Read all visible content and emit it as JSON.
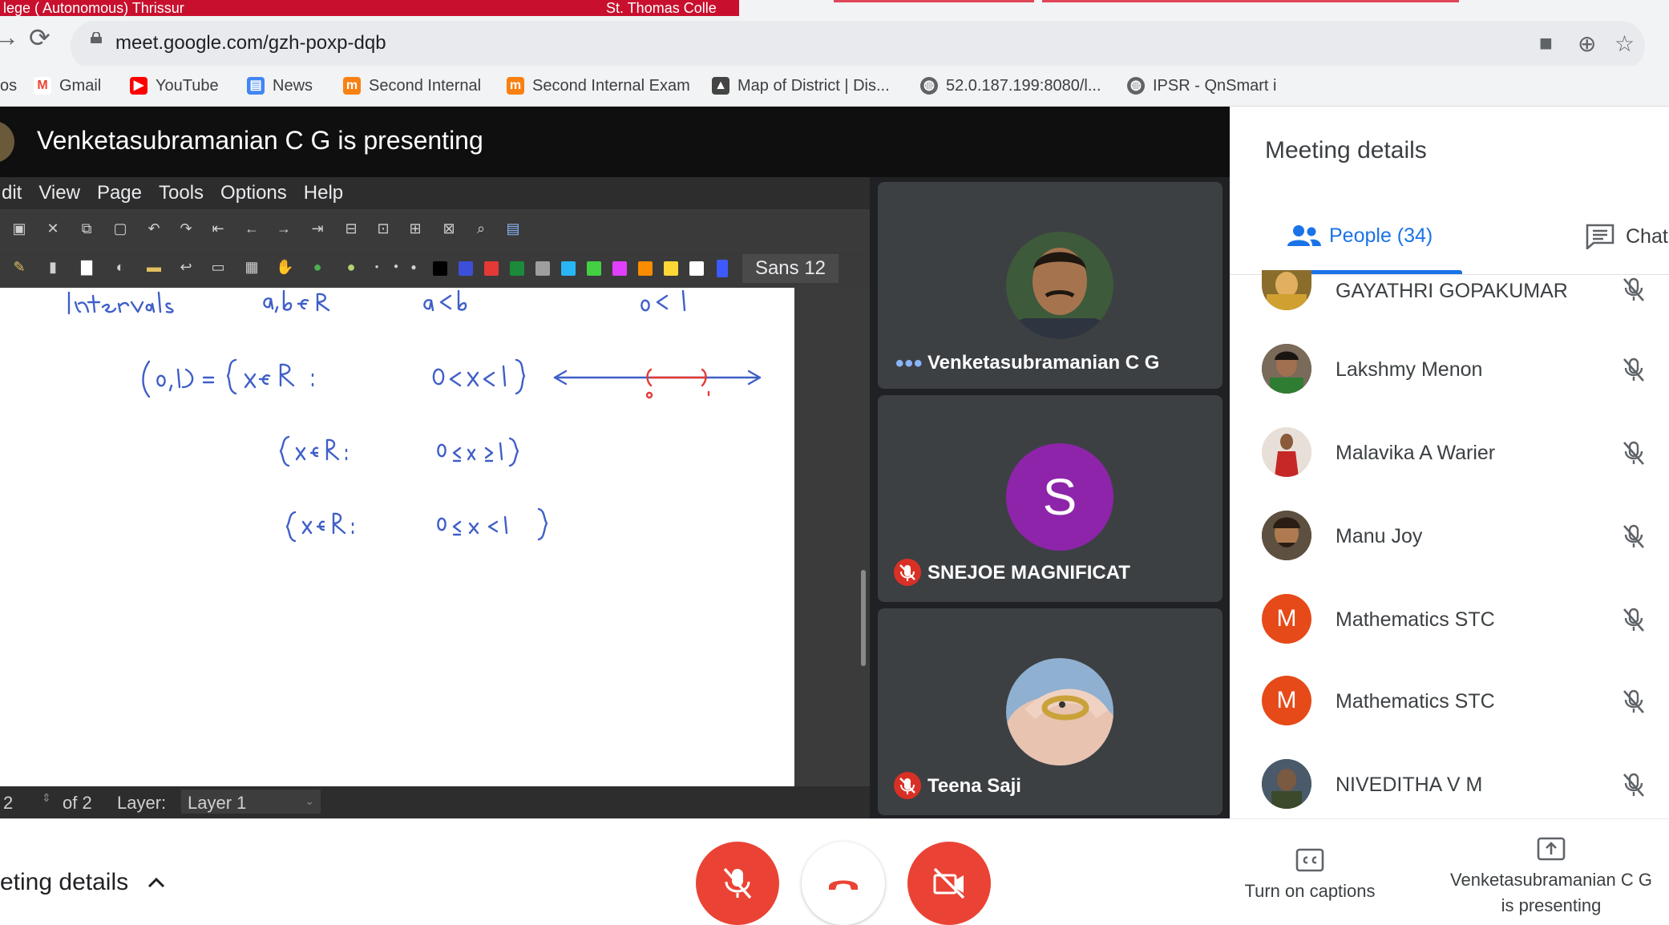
{
  "browser": {
    "tab_left_text": "lege ( Autonomous) Thrissur",
    "tab_right_text": "St. Thomas Colle",
    "url": "meet.google.com/gzh-poxp-dqb",
    "bookmarks": [
      {
        "label": "Gmail",
        "icon": "gmail-icon",
        "color": "#ea4335"
      },
      {
        "label": "YouTube",
        "icon": "youtube-icon",
        "color": "#ff0000"
      },
      {
        "label": "News",
        "icon": "news-icon",
        "color": "#4285f4"
      },
      {
        "label": "Second Internal",
        "icon": "moodle-icon",
        "color": "#f98012"
      },
      {
        "label": "Second Internal Exam",
        "icon": "moodle-icon",
        "color": "#f98012"
      },
      {
        "label": "Map of District | Dis...",
        "icon": "emblem-icon",
        "color": "#444444"
      },
      {
        "label": "52.0.187.199:8080/l...",
        "icon": "globe-icon",
        "color": "#5f6368"
      },
      {
        "label": "IPSR - QnSmart i",
        "icon": "globe-icon",
        "color": "#5f6368"
      }
    ],
    "bookmarks_cut": "os"
  },
  "presentation": {
    "title": "Venketasubramanian C G is presenting"
  },
  "xournal": {
    "menu": [
      "dit",
      "View",
      "Page",
      "Tools",
      "Options",
      "Help"
    ],
    "font": "Sans  12",
    "page_number": "2",
    "page_of": "of 2",
    "layer_label": "Layer:",
    "layer_value": "Layer 1"
  },
  "tiles": [
    {
      "name": "Venketasubramanian C G",
      "indicator": "•••",
      "muted": false
    },
    {
      "name": "SNEJOE MAGNIFICAT",
      "initial": "S",
      "avatar_color": "#8e24aa",
      "muted": true
    },
    {
      "name": "Teena Saji",
      "muted": true
    }
  ],
  "panel": {
    "title": "Meeting details",
    "tab_people": "People (34)",
    "tab_chat": "Chat",
    "people": [
      {
        "name": "GAYATHRI GOPAKUMAR",
        "avatar": "photo",
        "color": "#8a6d2b"
      },
      {
        "name": "Lakshmy Menon",
        "avatar": "photo",
        "color": "#5a4a3a"
      },
      {
        "name": "Malavika A Warier",
        "avatar": "photo",
        "color": "#b84a3a"
      },
      {
        "name": "Manu Joy",
        "avatar": "photo",
        "color": "#6d5a40"
      },
      {
        "name": "Mathematics STC",
        "avatar": "initial",
        "initial": "M",
        "color": "#e64a19"
      },
      {
        "name": "Mathematics STC",
        "avatar": "initial",
        "initial": "M",
        "color": "#e64a19"
      },
      {
        "name": "NIVEDITHA V M",
        "avatar": "photo",
        "color": "#4a5a3a"
      }
    ]
  },
  "bottom": {
    "meeting_details": "eting details",
    "captions": "Turn on captions",
    "presenting_line1": "Venketasubramanian C G",
    "presenting_line2": "is presenting"
  },
  "colors": {
    "accent": "#1a73e8",
    "danger": "#ea4335",
    "dark_bg": "#202124"
  }
}
